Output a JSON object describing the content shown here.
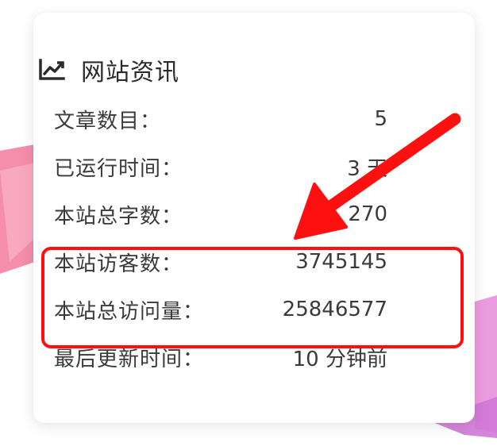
{
  "panel": {
    "title": "网站资讯",
    "icon": "trend-chart-icon"
  },
  "stats": [
    {
      "label": "文章数目：",
      "value": "5"
    },
    {
      "label": "已运行时间：",
      "value": "3 天"
    },
    {
      "label": "本站总字数：",
      "value": "270"
    },
    {
      "label": "本站访客数：",
      "value": "3745145"
    },
    {
      "label": "本站总访问量：",
      "value": "25846577"
    },
    {
      "label": "最后更新时间：",
      "value": "10 分钟前"
    }
  ],
  "annotation": {
    "highlight_color": "#ff1010",
    "arrow_color": "#ff1010"
  },
  "colors": {
    "background_shapes": [
      "#f06b8e",
      "#f7a5bd",
      "#e07ad0",
      "#c86fd8"
    ]
  }
}
